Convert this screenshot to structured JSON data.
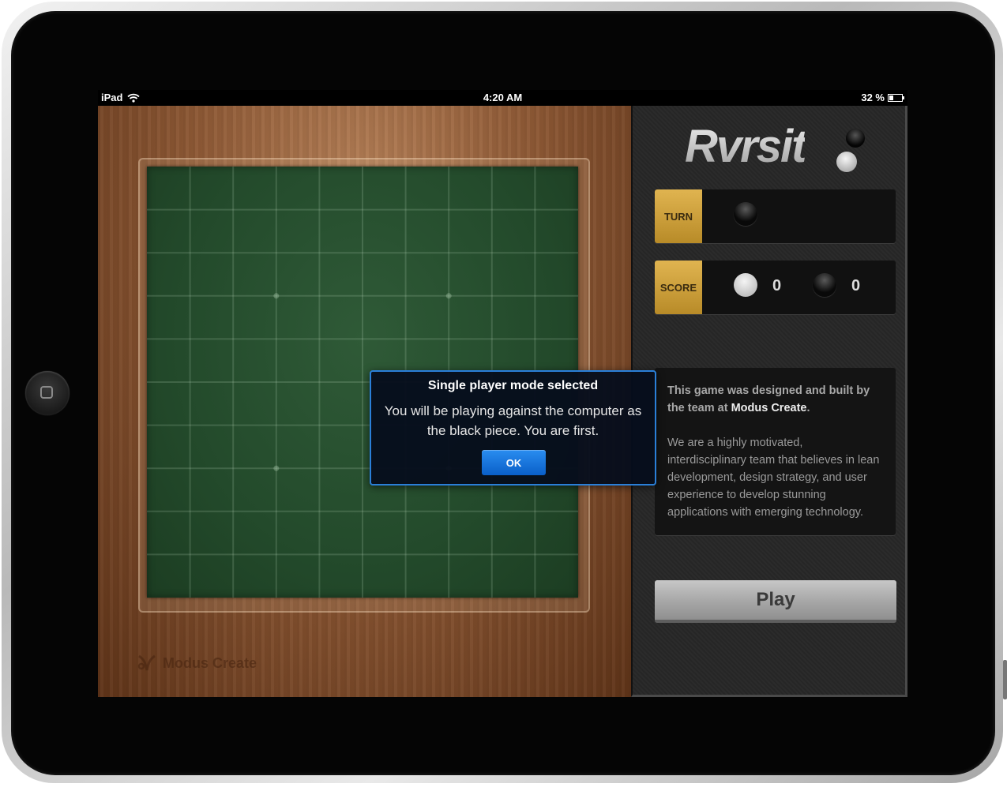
{
  "status_bar": {
    "device": "iPad",
    "time": "4:20 AM",
    "battery": "32 %"
  },
  "game": {
    "logo": "Rvrsit",
    "turn": {
      "label": "TURN",
      "current_piece": "black"
    },
    "score": {
      "label": "SCORE",
      "white": "0",
      "black": "0"
    },
    "about": {
      "lead_prefix": "This game was designed and built by the team at ",
      "lead_brand": "Modus Create",
      "lead_suffix": ".",
      "body": "We are a highly motivated, interdisciplinary team that believes in lean development, design strategy, and user experience to develop stunning applications with emerging technology."
    },
    "play_label": "Play",
    "watermark": "Modus Create"
  },
  "dialog": {
    "title": "Single player mode selected",
    "message": "You will be playing against the computer as the black piece. You are first.",
    "ok_label": "OK"
  },
  "board": {
    "rows": 10,
    "cols": 10
  },
  "colors": {
    "accent_gold": "#d4a440",
    "dialog_border": "#2a7fd8",
    "board_green": "#2a5232"
  }
}
